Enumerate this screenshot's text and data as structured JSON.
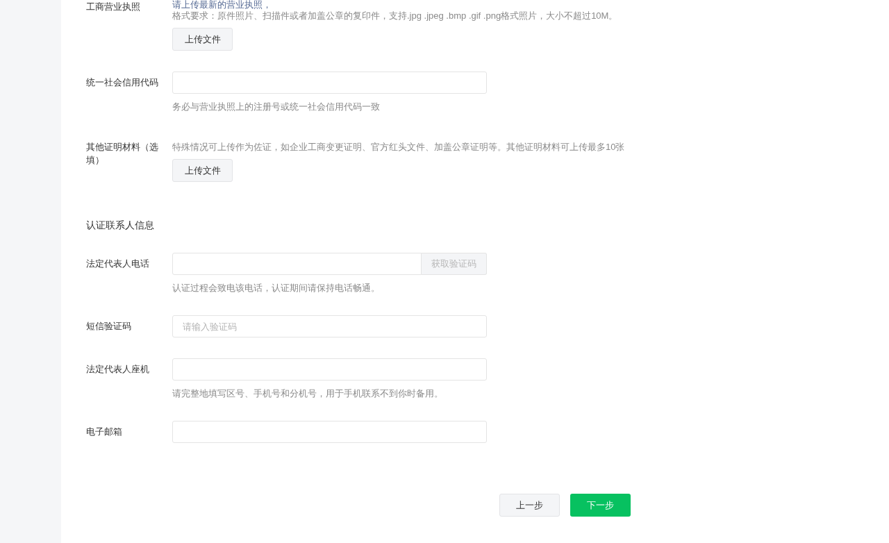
{
  "sections": [
    {
      "fields": [
        {
          "kind": "upload",
          "label": "工商营业执照",
          "notice": "请上传最新的营业执照，",
          "hint": "格式要求：原件照片、扫描件或者加盖公章的复印件，支持.jpg .jpeg .bmp .gif .png格式照片，大小不超过10M。",
          "button": "上传文件"
        },
        {
          "kind": "text",
          "label": "统一社会信用代码",
          "hint": "务必与营业执照上的注册号或统一社会信用代码一致"
        },
        {
          "kind": "upload",
          "label": "其他证明材料（选填）",
          "hint": "特殊情况可上传作为佐证，如企业工商变更证明、官方红头文件、加盖公章证明等。其他证明材料可上传最多10张",
          "button": "上传文件"
        }
      ]
    },
    {
      "title": "认证联系人信息",
      "fields": [
        {
          "kind": "code",
          "label": "法定代表人电话",
          "button": {
            "label": "获取验证码",
            "disabled": true
          },
          "hint": "认证过程会致电该电话，认证期间请保持电话畅通。"
        },
        {
          "kind": "text",
          "label": "短信验证码",
          "placeholder": "请输入验证码"
        },
        {
          "kind": "text",
          "label": "法定代表人座机",
          "hint": "请完整地填写区号、手机号和分机号，用于手机联系不到你时备用。"
        },
        {
          "kind": "text",
          "label": "电子邮箱"
        }
      ]
    }
  ],
  "actions": [
    {
      "kind": "secondary",
      "label": "上一步"
    },
    {
      "kind": "primary",
      "label": "下一步"
    }
  ]
}
